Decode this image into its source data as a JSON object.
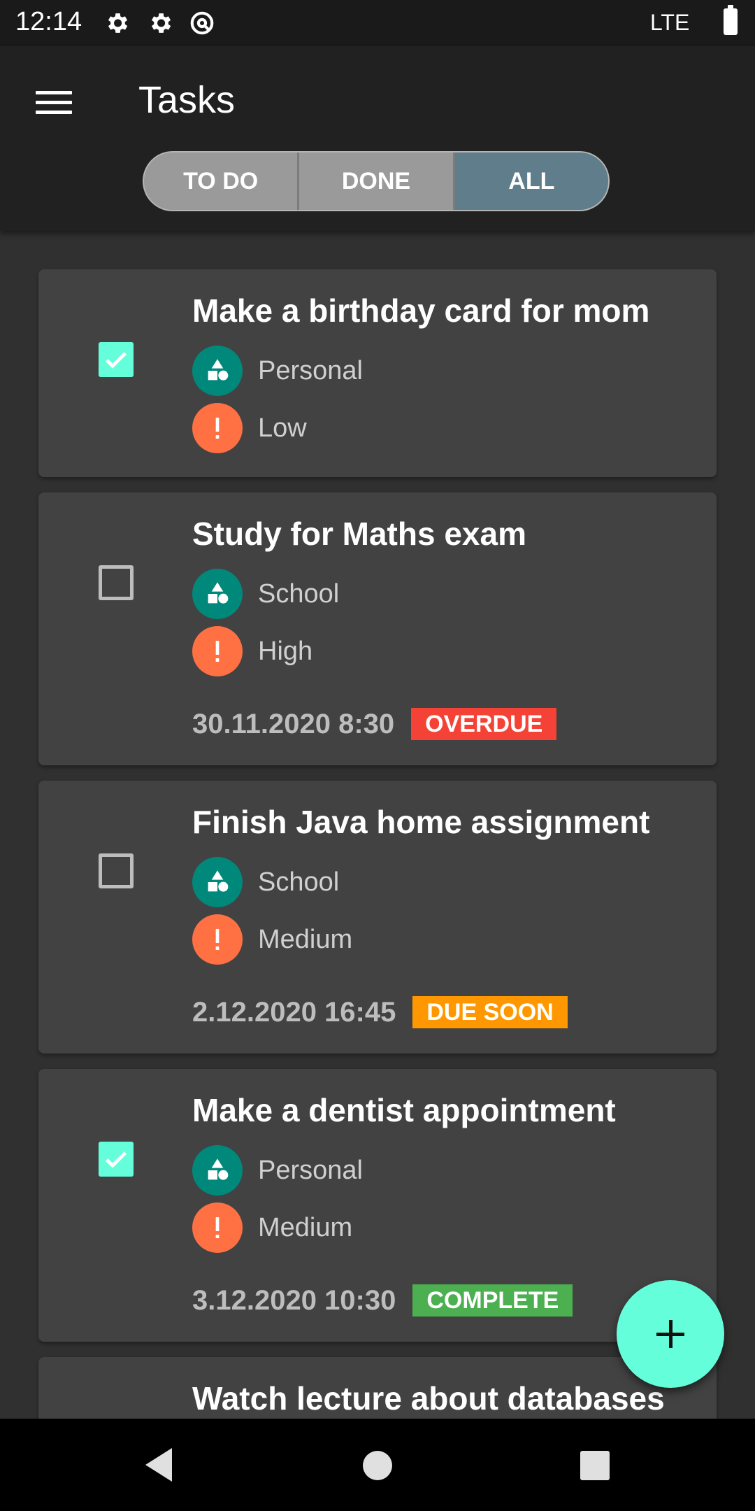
{
  "status_bar": {
    "time": "12:14",
    "icons": [
      "gear-icon",
      "gear-icon",
      "at-sign-icon"
    ],
    "network": "LTE"
  },
  "app_bar": {
    "title": "Tasks",
    "tabs": [
      {
        "label": "TO DO",
        "active": false
      },
      {
        "label": "DONE",
        "active": false
      },
      {
        "label": "ALL",
        "active": true
      }
    ]
  },
  "tasks": [
    {
      "title": "Make a birthday card for mom",
      "checked": true,
      "category": "Personal",
      "priority": "Low",
      "due": "",
      "badge": ""
    },
    {
      "title": "Study for Maths exam",
      "checked": false,
      "category": "School",
      "priority": "High",
      "due": "30.11.2020 8:30",
      "badge": "OVERDUE"
    },
    {
      "title": "Finish Java home assignment",
      "checked": false,
      "category": "School",
      "priority": "Medium",
      "due": "2.12.2020 16:45",
      "badge": "DUE SOON"
    },
    {
      "title": "Make a dentist appointment",
      "checked": true,
      "category": "Personal",
      "priority": "Medium",
      "due": "3.12.2020 10:30",
      "badge": "COMPLETE"
    },
    {
      "title": "Watch lecture about databases",
      "checked": false,
      "category": "",
      "priority": "",
      "due": "",
      "badge": ""
    }
  ],
  "colors": {
    "accent": "#64ffda",
    "active_tab": "#607d8b",
    "category_icon": "#00897b",
    "priority_icon": "#ff7043",
    "badge_overdue": "#f44336",
    "badge_due_soon": "#ff9800",
    "badge_complete": "#4caf50"
  },
  "fab": {
    "icon": "plus-icon"
  }
}
